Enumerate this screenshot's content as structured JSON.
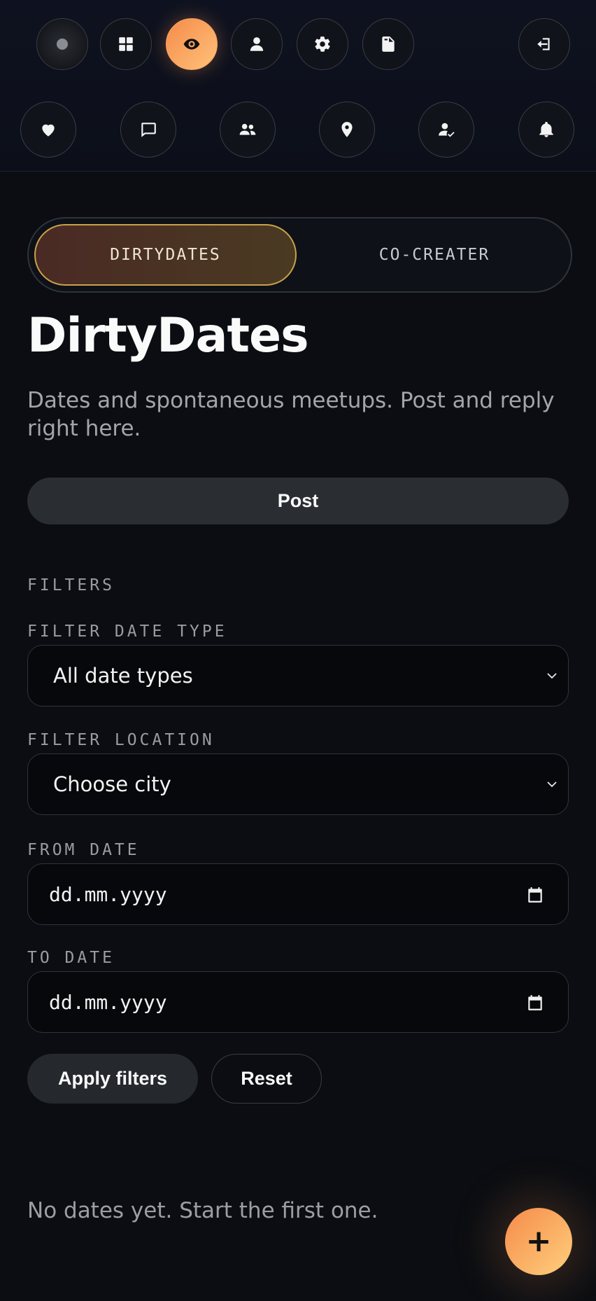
{
  "nav": {
    "row1": [
      {
        "icon": "status-dot-icon",
        "active": false
      },
      {
        "icon": "grid-icon",
        "active": false
      },
      {
        "icon": "eye-icon",
        "active": true
      },
      {
        "icon": "user-icon",
        "active": false
      },
      {
        "icon": "gear-icon",
        "active": false
      },
      {
        "icon": "file-icon",
        "active": false
      },
      {
        "icon": "logout-icon",
        "active": false
      }
    ],
    "row2": [
      {
        "icon": "heart-icon"
      },
      {
        "icon": "chat-icon"
      },
      {
        "icon": "users-icon"
      },
      {
        "icon": "location-pin-icon"
      },
      {
        "icon": "user-check-icon"
      },
      {
        "icon": "bell-icon"
      }
    ]
  },
  "tabs": [
    {
      "label": "DIRTYDATES",
      "selected": true
    },
    {
      "label": "CO-CREATER",
      "selected": false
    }
  ],
  "page": {
    "title": "DirtyDates",
    "subtitle": "Dates and spontaneous meetups. Post and reply right here.",
    "post_label": "Post"
  },
  "filters": {
    "heading": "FILTERS",
    "date_type_label": "FILTER DATE TYPE",
    "date_type_value": "All date types",
    "location_label": "FILTER LOCATION",
    "location_value": "Choose city",
    "from_label": "FROM DATE",
    "from_placeholder": "dd.mm.yyyy",
    "to_label": "TO DATE",
    "to_placeholder": "dd.mm.yyyy",
    "apply_label": "Apply filters",
    "reset_label": "Reset"
  },
  "empty_state": "No dates yet. Start the first one.",
  "fab": {
    "label": "+",
    "icon": "plus-icon"
  },
  "colors": {
    "accent_start": "#f58b4a",
    "accent_end": "#ffc27a",
    "background": "#0b0d12",
    "tab_border": "#c9a24a"
  }
}
